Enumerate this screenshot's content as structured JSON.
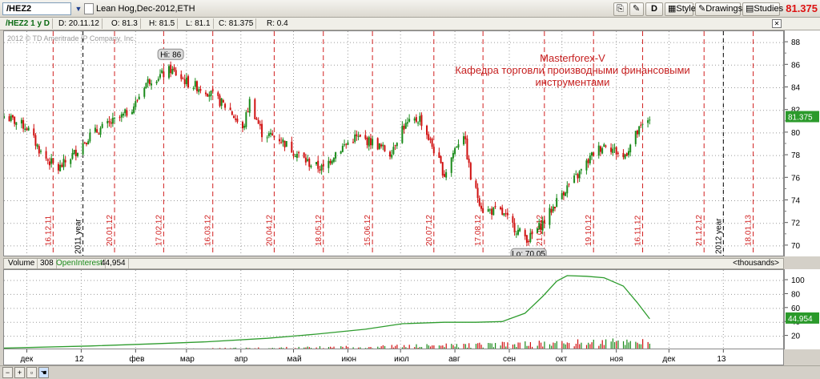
{
  "toolbar": {
    "symbol": "/HEZ2",
    "description": "Lean Hog,Dec-2012,ETH",
    "d_label": "D",
    "style_label": "Style",
    "drawings_label": "Drawings",
    "studies_label": "Studies",
    "last_price": "81.375"
  },
  "header": {
    "symbol_tag": "/HEZ2 1 y D",
    "date": "D: 20.11.12",
    "open": "O: 81.3",
    "high": "H: 81.5",
    "low": "L: 81.1",
    "close": "C: 81.375",
    "range": "R: 0.4"
  },
  "price_panel": {
    "copyright": "2012 © TD Ameritrade IP Company, Inc.",
    "annotation_line1": "Masterforex-V",
    "annotation_line2": "Кафедра торговли производными финансовыми",
    "annotation_line3": "инструментами",
    "hi_label": "Hi: 86",
    "lo_label": "Lo: 70.05",
    "last_badge": "81.375",
    "vline_labels": [
      "16.12.11",
      "20.01.12",
      "17.02.12",
      "16.03.12",
      "20.04.12",
      "18.05.12",
      "15.06.12",
      "20.07.12",
      "17.08.12",
      "21.09.12",
      "19.10.12",
      "16.11.12",
      "21.12.12",
      "18.01.13"
    ],
    "year_labels": [
      "2011 year",
      "2012 year"
    ],
    "y_ticks": [
      "88",
      "86",
      "84",
      "82",
      "80",
      "78",
      "76",
      "74",
      "72",
      "70"
    ]
  },
  "volume_panel": {
    "volume_label": "Volume",
    "volume_value": "308",
    "oi_label": "OpenInterest",
    "oi_value": "44,954",
    "units": "<thousands>",
    "oi_badge": "44.954",
    "y_ticks": [
      "100",
      "80",
      "60",
      "40",
      "20"
    ]
  },
  "time_axis": {
    "months": [
      "дек",
      "12",
      "фев",
      "мар",
      "апр",
      "май",
      "июн",
      "июл",
      "авг",
      "сен",
      "окт",
      "ноя",
      "дек",
      "13"
    ]
  },
  "colors": {
    "up": "#1a8a1a",
    "down": "#d01010",
    "oi_line": "#2e9c2e",
    "vline": "#d12020",
    "year_line": "#000000",
    "badge_bg": "#2b9a2b"
  },
  "chart_data": [
    {
      "type": "candlestick",
      "title": "Lean Hog,Dec-2012,ETH",
      "ylim": [
        69,
        89
      ],
      "x_start": "2011-11-18",
      "x_end": "2013-02-05",
      "high": 86,
      "low": 70.05,
      "last": 81.375,
      "points": [
        [
          "2011-11-18",
          81.5
        ],
        [
          "2011-12-01",
          80.5
        ],
        [
          "2011-12-10",
          78.0
        ],
        [
          "2011-12-16",
          77.2
        ],
        [
          "2011-12-19",
          76.8
        ],
        [
          "2011-12-28",
          78.2
        ],
        [
          "2012-01-06",
          79.8
        ],
        [
          "2012-01-16",
          80.7
        ],
        [
          "2012-01-25",
          81.5
        ],
        [
          "2012-02-01",
          82.6
        ],
        [
          "2012-02-06",
          84.3
        ],
        [
          "2012-02-10",
          84.8
        ],
        [
          "2012-02-17",
          85.2
        ],
        [
          "2012-02-21",
          85.6
        ],
        [
          "2012-03-02",
          84.4
        ],
        [
          "2012-03-12",
          83.8
        ],
        [
          "2012-03-19",
          82.9
        ],
        [
          "2012-03-26",
          82.0
        ],
        [
          "2012-04-02",
          80.2
        ],
        [
          "2012-04-06",
          82.8
        ],
        [
          "2012-04-13",
          80.0
        ],
        [
          "2012-04-23",
          79.5
        ],
        [
          "2012-05-01",
          78.4
        ],
        [
          "2012-05-10",
          77.3
        ],
        [
          "2012-05-18",
          76.8
        ],
        [
          "2012-05-25",
          78.3
        ],
        [
          "2012-06-05",
          79.6
        ],
        [
          "2012-06-15",
          79.2
        ],
        [
          "2012-06-25",
          78.2
        ],
        [
          "2012-07-02",
          80.5
        ],
        [
          "2012-07-12",
          81.3
        ],
        [
          "2012-07-20",
          78.5
        ],
        [
          "2012-07-26",
          76.3
        ],
        [
          "2012-08-02",
          79.0
        ],
        [
          "2012-08-06",
          80.0
        ],
        [
          "2012-08-10",
          76.0
        ],
        [
          "2012-08-17",
          73.2
        ],
        [
          "2012-08-27",
          73.0
        ],
        [
          "2012-09-06",
          71.3
        ],
        [
          "2012-09-12",
          70.6
        ],
        [
          "2012-09-21",
          72.2
        ],
        [
          "2012-10-01",
          74.7
        ],
        [
          "2012-10-10",
          76.2
        ],
        [
          "2012-10-19",
          78.2
        ],
        [
          "2012-10-26",
          79.1
        ],
        [
          "2012-11-05",
          77.8
        ],
        [
          "2012-11-12",
          79.8
        ],
        [
          "2012-11-20",
          81.4
        ]
      ]
    },
    {
      "type": "line",
      "name": "OpenInterest",
      "ylim": [
        0,
        115
      ],
      "last": 44.954,
      "points": [
        [
          "2011-11-18",
          3
        ],
        [
          "2012-01-06",
          6
        ],
        [
          "2012-02-10",
          9
        ],
        [
          "2012-03-12",
          12
        ],
        [
          "2012-04-16",
          17
        ],
        [
          "2012-05-14",
          23
        ],
        [
          "2012-06-11",
          30
        ],
        [
          "2012-07-02",
          38
        ],
        [
          "2012-07-26",
          40
        ],
        [
          "2012-08-13",
          40
        ],
        [
          "2012-08-28",
          41
        ],
        [
          "2012-09-10",
          53
        ],
        [
          "2012-09-20",
          77
        ],
        [
          "2012-09-28",
          99
        ],
        [
          "2012-10-04",
          107
        ],
        [
          "2012-10-15",
          106
        ],
        [
          "2012-10-25",
          104
        ],
        [
          "2012-11-05",
          92
        ],
        [
          "2012-11-13",
          68
        ],
        [
          "2012-11-20",
          45
        ]
      ]
    }
  ]
}
